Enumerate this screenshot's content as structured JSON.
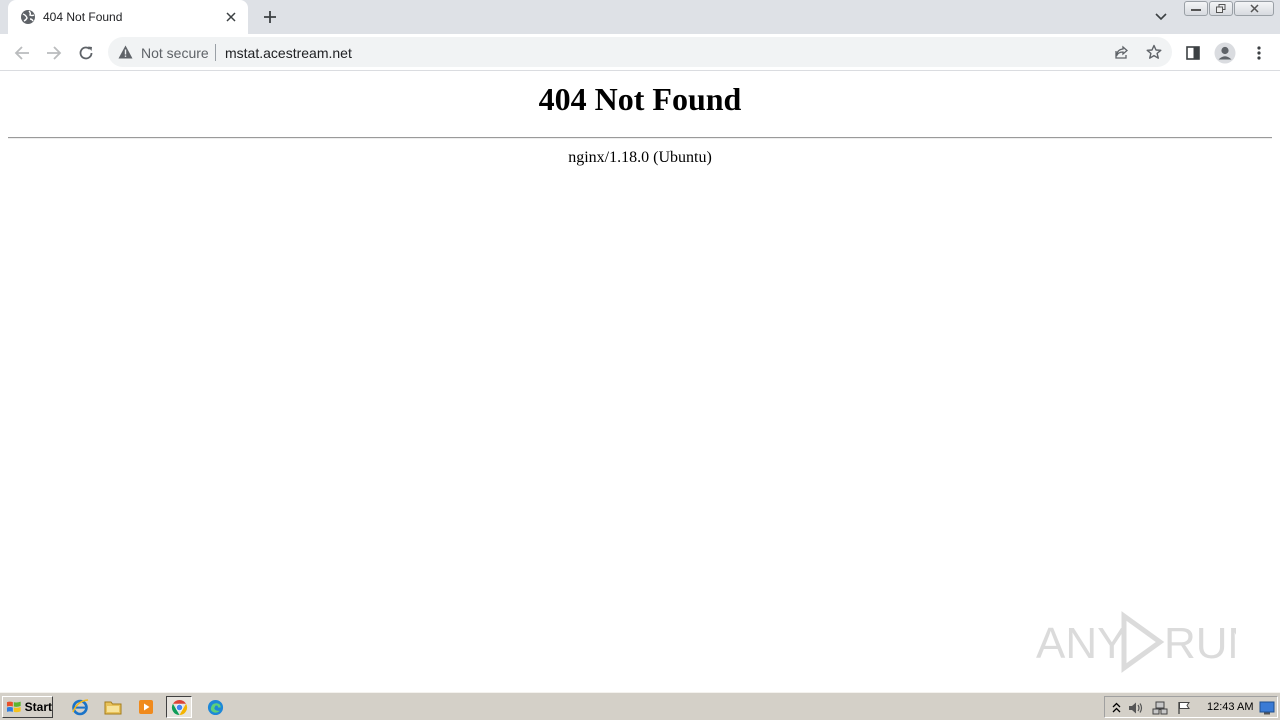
{
  "browser": {
    "tab": {
      "title": "404 Not Found",
      "favicon": "globe-icon"
    },
    "new_tab_label": "+",
    "address_bar": {
      "security_label": "Not secure",
      "url": "mstat.acestream.net"
    }
  },
  "page": {
    "heading": "404 Not Found",
    "server_signature": "nginx/1.18.0 (Ubuntu)"
  },
  "watermark": {
    "text": "ANY RUN"
  },
  "taskbar": {
    "start_label": "Start",
    "pinned": [
      "internet-explorer-icon",
      "file-explorer-icon",
      "media-player-icon",
      "chrome-icon",
      "edge-icon"
    ],
    "clock": "12:43 AM"
  },
  "colors": {
    "tabstrip": "#dee1e6",
    "omnibox": "#f1f3f4",
    "taskbar": "#d4d0c8",
    "icon_gray": "#5f6368"
  }
}
